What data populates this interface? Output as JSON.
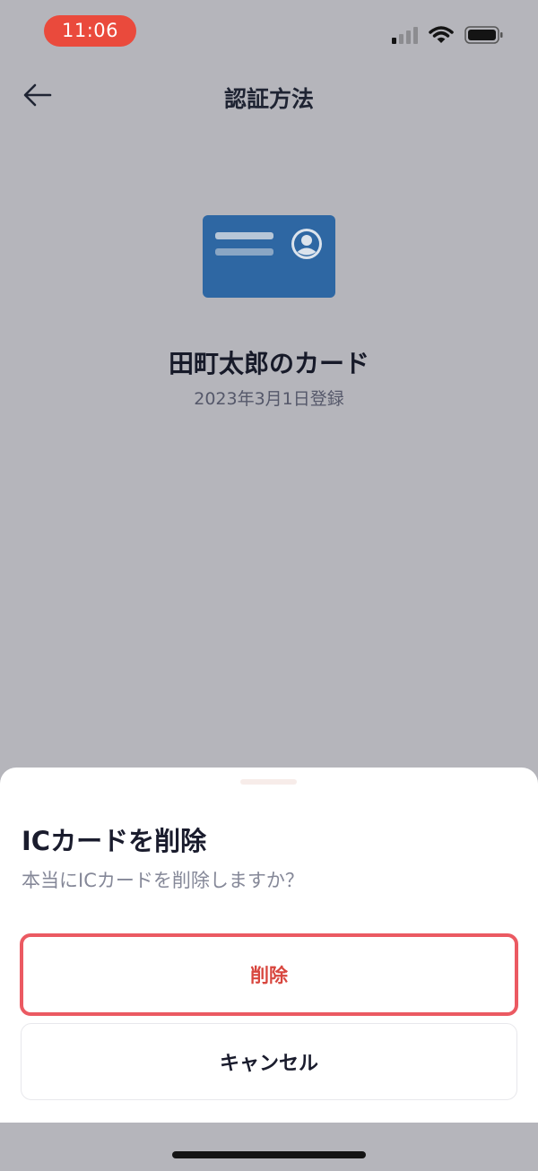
{
  "status_bar": {
    "time": "11:06",
    "icons": [
      "signal-icon",
      "wifi-icon",
      "battery-icon"
    ]
  },
  "header": {
    "title": "認証方法",
    "back_icon": "arrow-left-icon"
  },
  "card": {
    "icon": "id-card-icon",
    "name": "田町太郎のカード",
    "registered_date": "2023年3月1日登録",
    "color": "#2e67a3"
  },
  "sheet": {
    "title": "ICカードを削除",
    "message": "本当にICカードを削除しますか？",
    "delete_label": "削除",
    "cancel_label": "キャンセル",
    "delete_color": "#d8463e"
  },
  "colors": {
    "time_pill": "#ea4a3c",
    "overlay_background": "#b5b5bb"
  }
}
